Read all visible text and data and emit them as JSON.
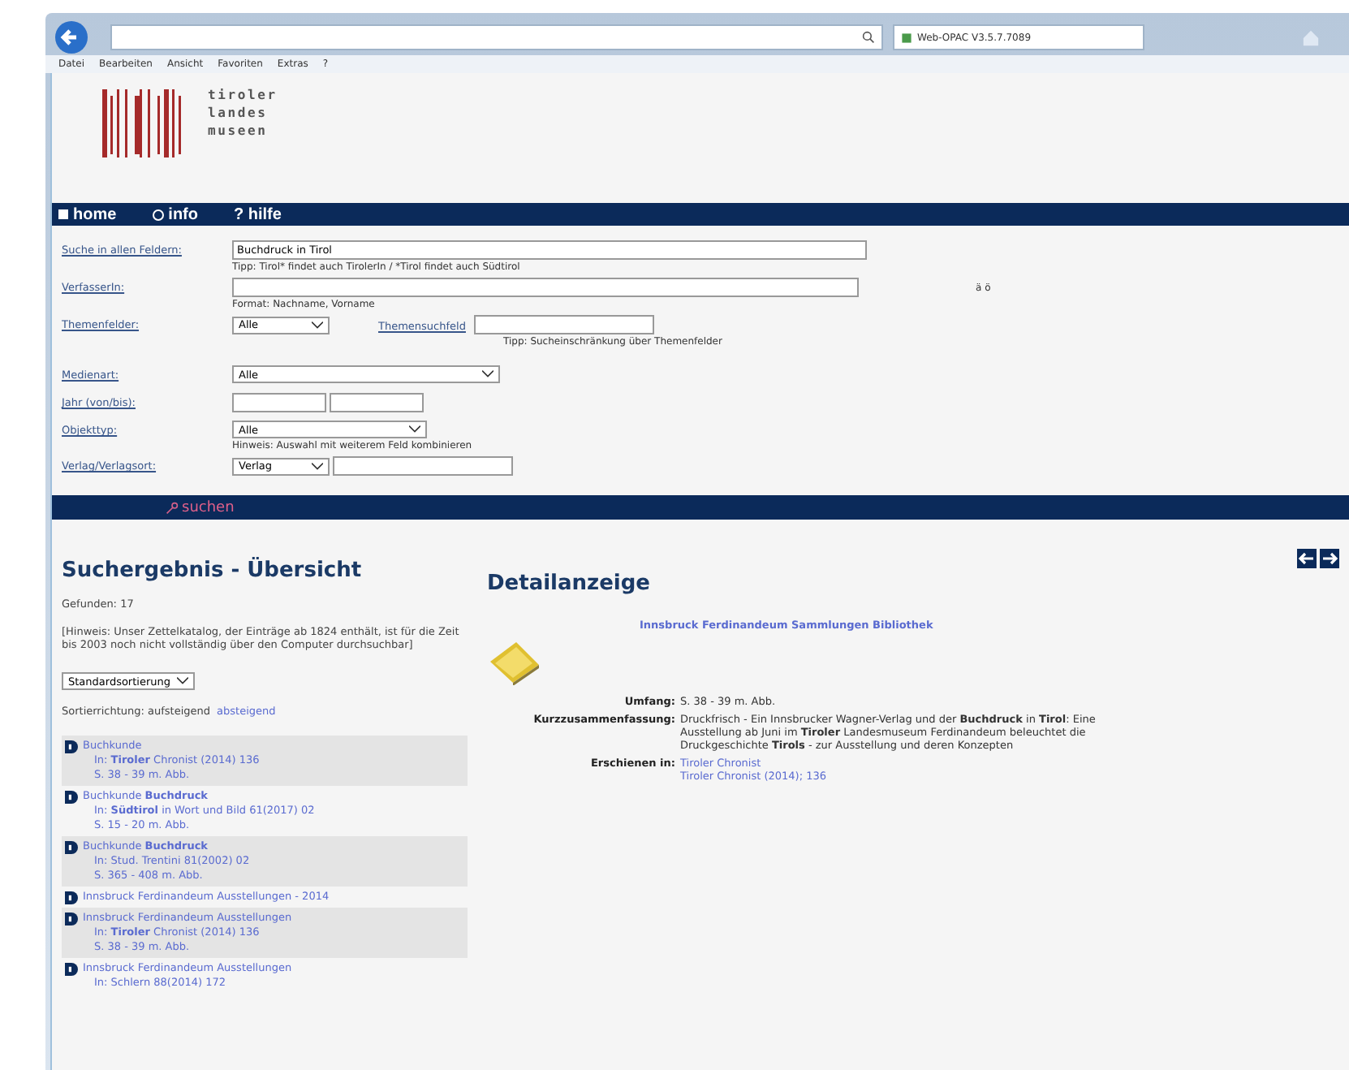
{
  "browser": {
    "tab_title": "Web-OPAC V3.5.7.7089",
    "menu": [
      "Datei",
      "Bearbeiten",
      "Ansicht",
      "Favoriten",
      "Extras",
      "?"
    ]
  },
  "logo": {
    "lines": [
      "tiroler",
      "landes",
      "museen"
    ]
  },
  "nav": [
    {
      "label": "home"
    },
    {
      "label": "info"
    },
    {
      "label": "? hilfe"
    }
  ],
  "search_form": {
    "rows": [
      {
        "kind": "text",
        "label": "Suche in allen Feldern:",
        "value": "Buchdruck in Tirol",
        "hint": "Tipp: Tirol* findet auch TirolerIn / *Tirol findet auch Südtirol"
      },
      {
        "kind": "text",
        "label": "VerfasserIn:",
        "hint": "Format: Nachname, Vorname",
        "extra": "ä ö"
      },
      {
        "kind": "select_text",
        "label": "Themenfelder:",
        "select": "Alle",
        "field_label": "Themensuchfeld",
        "hint": "Tipp: Sucheinschränkung über Themenfelder"
      },
      {
        "kind": "select",
        "label": "Medienart:",
        "select": "Alle"
      },
      {
        "kind": "range",
        "label": "Jahr (von/bis):"
      },
      {
        "kind": "select",
        "label": "Objekttyp:",
        "select": "Alle",
        "hint": "Hinweis: Auswahl mit weiterem Feld kombinieren"
      },
      {
        "kind": "select_text",
        "label": "Verlag/Verlagsort:",
        "select": "Verlag"
      }
    ],
    "submit": "suchen"
  },
  "results": {
    "title": "Suchergebnis - Übersicht",
    "found": "Gefunden: 17",
    "notice": "[Hinweis: Unser Zettelkatalog, der Einträge ab 1824 enthält, ist für die Zeit bis 2003 noch nicht vollständig über den Computer durchsuchbar]",
    "sort_select": "Standardsortierung",
    "sort_label": "Sortierrichtung: aufsteigend",
    "sort_link": "absteigend",
    "items": [
      {
        "title": "Buchkunde",
        "source": "In: **Tiroler** Chronist (2014) 136",
        "pages": "S. 38 - 39 m. Abb."
      },
      {
        "title": "Buchkunde **Buchdruck**",
        "source": "In: **Südtirol** in Wort und Bild 61(2017) 02",
        "pages": "S. 15 - 20 m. Abb."
      },
      {
        "title": "Buchkunde **Buchdruck**",
        "source": "In: Stud. Trentini 81(2002) 02",
        "pages": "S. 365 - 408 m. Abb."
      },
      {
        "title": "Innsbruck Ferdinandeum Ausstellungen - 2014"
      },
      {
        "title": "Innsbruck Ferdinandeum Ausstellungen",
        "source": "In: **Tiroler** Chronist (2014) 136",
        "pages": "S. 38 - 39 m. Abb."
      },
      {
        "title": "Innsbruck Ferdinandeum Ausstellungen",
        "source": "In: Schlern 88(2014) 172"
      }
    ]
  },
  "detail": {
    "title": "Detailanzeige",
    "heading_link": "Innsbruck Ferdinandeum Sammlungen Bibliothek",
    "fields": [
      {
        "label": "Umfang:",
        "values": [
          "S. 38 - 39 m. Abb."
        ],
        "kind": "text"
      },
      {
        "label": "Kurzzusammenfassung:",
        "values": [
          "Druckfrisch - Ein Innsbrucker Wagner-Verlag und der **Buchdruck** in **Tirol**: Eine Ausstellung ab Juni im **Tiroler** Landesmuseum Ferdinandeum beleuchtet die Druckgeschichte **Tirols** - zur Ausstellung und deren Konzepten"
        ],
        "kind": "text"
      },
      {
        "label": "Erschienen in:",
        "values": [
          "Tiroler Chronist",
          "Tiroler Chronist (2014); 136"
        ],
        "kind": "link"
      }
    ]
  }
}
